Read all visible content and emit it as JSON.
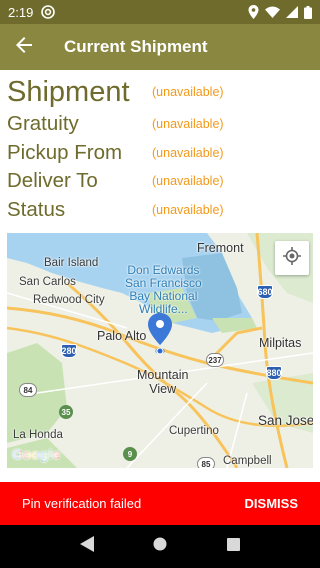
{
  "status_bar": {
    "time": "2:19",
    "icons": [
      "at-sign-icon",
      "location-icon",
      "wifi-icon",
      "signal-icon",
      "battery-icon"
    ]
  },
  "app_bar": {
    "title": "Current Shipment",
    "back_icon": "back-arrow-icon"
  },
  "details": {
    "shipment_label": "Shipment",
    "shipment_value": "(unavailable)",
    "gratuity_label": "Gratuity",
    "gratuity_value": "(unavailable)",
    "pickup_label": "Pickup From",
    "pickup_value": "(unavailable)",
    "deliver_label": "Deliver To",
    "deliver_value": "(unavailable)",
    "status_label": "Status",
    "status_value": "(unavailable)"
  },
  "map": {
    "labels": {
      "fremont": "Fremont",
      "bair_island": "Bair Island",
      "san_carlos": "San Carlos",
      "redwood_city": "Redwood City",
      "refuge_line1": "Don Edwards",
      "refuge_line2": "San Francisco",
      "refuge_line3": "Bay National",
      "refuge_line4": "Wildlife...",
      "palo_alto": "Palo Alto",
      "milpitas": "Milpitas",
      "mountain_view_1": "Mountain",
      "mountain_view_2": "View",
      "la_honda": "La Honda",
      "cupertino": "Cupertino",
      "san_jose": "San Jose",
      "campbell": "Campbell"
    },
    "shields": {
      "i680": "680",
      "i280": "280",
      "r237": "237",
      "i880": "880",
      "r84": "84",
      "r35": "35",
      "r9": "9",
      "r85": "85"
    },
    "google_logo": "Google",
    "locate_icon": "my-location-icon",
    "marker_icon": "location-pin-icon",
    "colors": {
      "water": "#a8d3f0",
      "park": "#c8e2b4",
      "land": "#eef0e6",
      "highway": "#f7c35a"
    }
  },
  "snackbar": {
    "message": "Pin verification failed",
    "action": "DISMISS",
    "background": "#ff0000"
  },
  "nav_bar": {
    "icons": [
      "back-triangle-icon",
      "home-circle-icon",
      "recents-square-icon"
    ]
  },
  "theme": {
    "primary": "#8a8740",
    "primary_dark": "#6e6b2c",
    "accent": "#f39a1b"
  }
}
